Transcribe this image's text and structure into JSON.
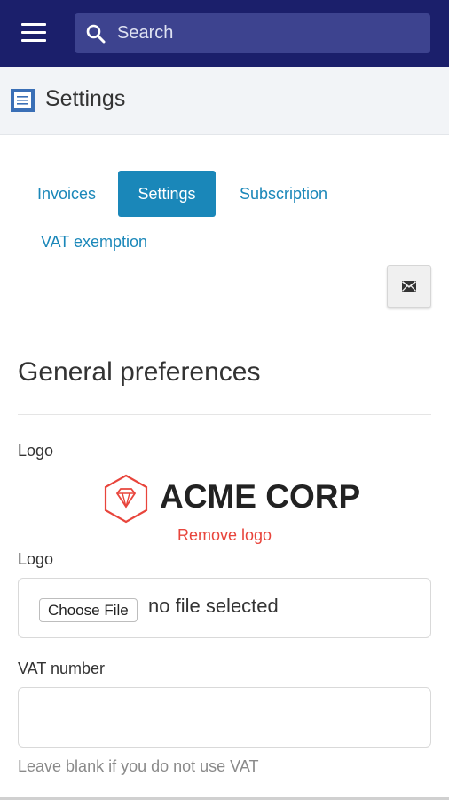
{
  "topbar": {
    "search_placeholder": "Search",
    "menu_icon": "hamburger-menu-icon",
    "search_icon": "search-icon",
    "background_color": "#1b1f6b"
  },
  "page": {
    "title": "Settings",
    "icon": "document-icon"
  },
  "tabs": [
    {
      "label": "Invoices",
      "active": false
    },
    {
      "label": "Settings",
      "active": true
    },
    {
      "label": "Subscription",
      "active": false
    },
    {
      "label": "VAT exemption",
      "active": false
    }
  ],
  "actions": {
    "mail_icon": "envelope-icon"
  },
  "general": {
    "heading": "General preferences",
    "logo_label": "Logo",
    "logo_text": "ACME CORP",
    "remove_logo": "Remove logo",
    "upload_label": "Logo",
    "choose_file": "Choose File",
    "file_status": "no file selected",
    "vat_label": "VAT number",
    "vat_value": "",
    "vat_help": "Leave blank if you do not use VAT"
  },
  "colors": {
    "accent": "#1a87b9",
    "danger": "#e8453c",
    "logo_mark": "#e8453c"
  }
}
